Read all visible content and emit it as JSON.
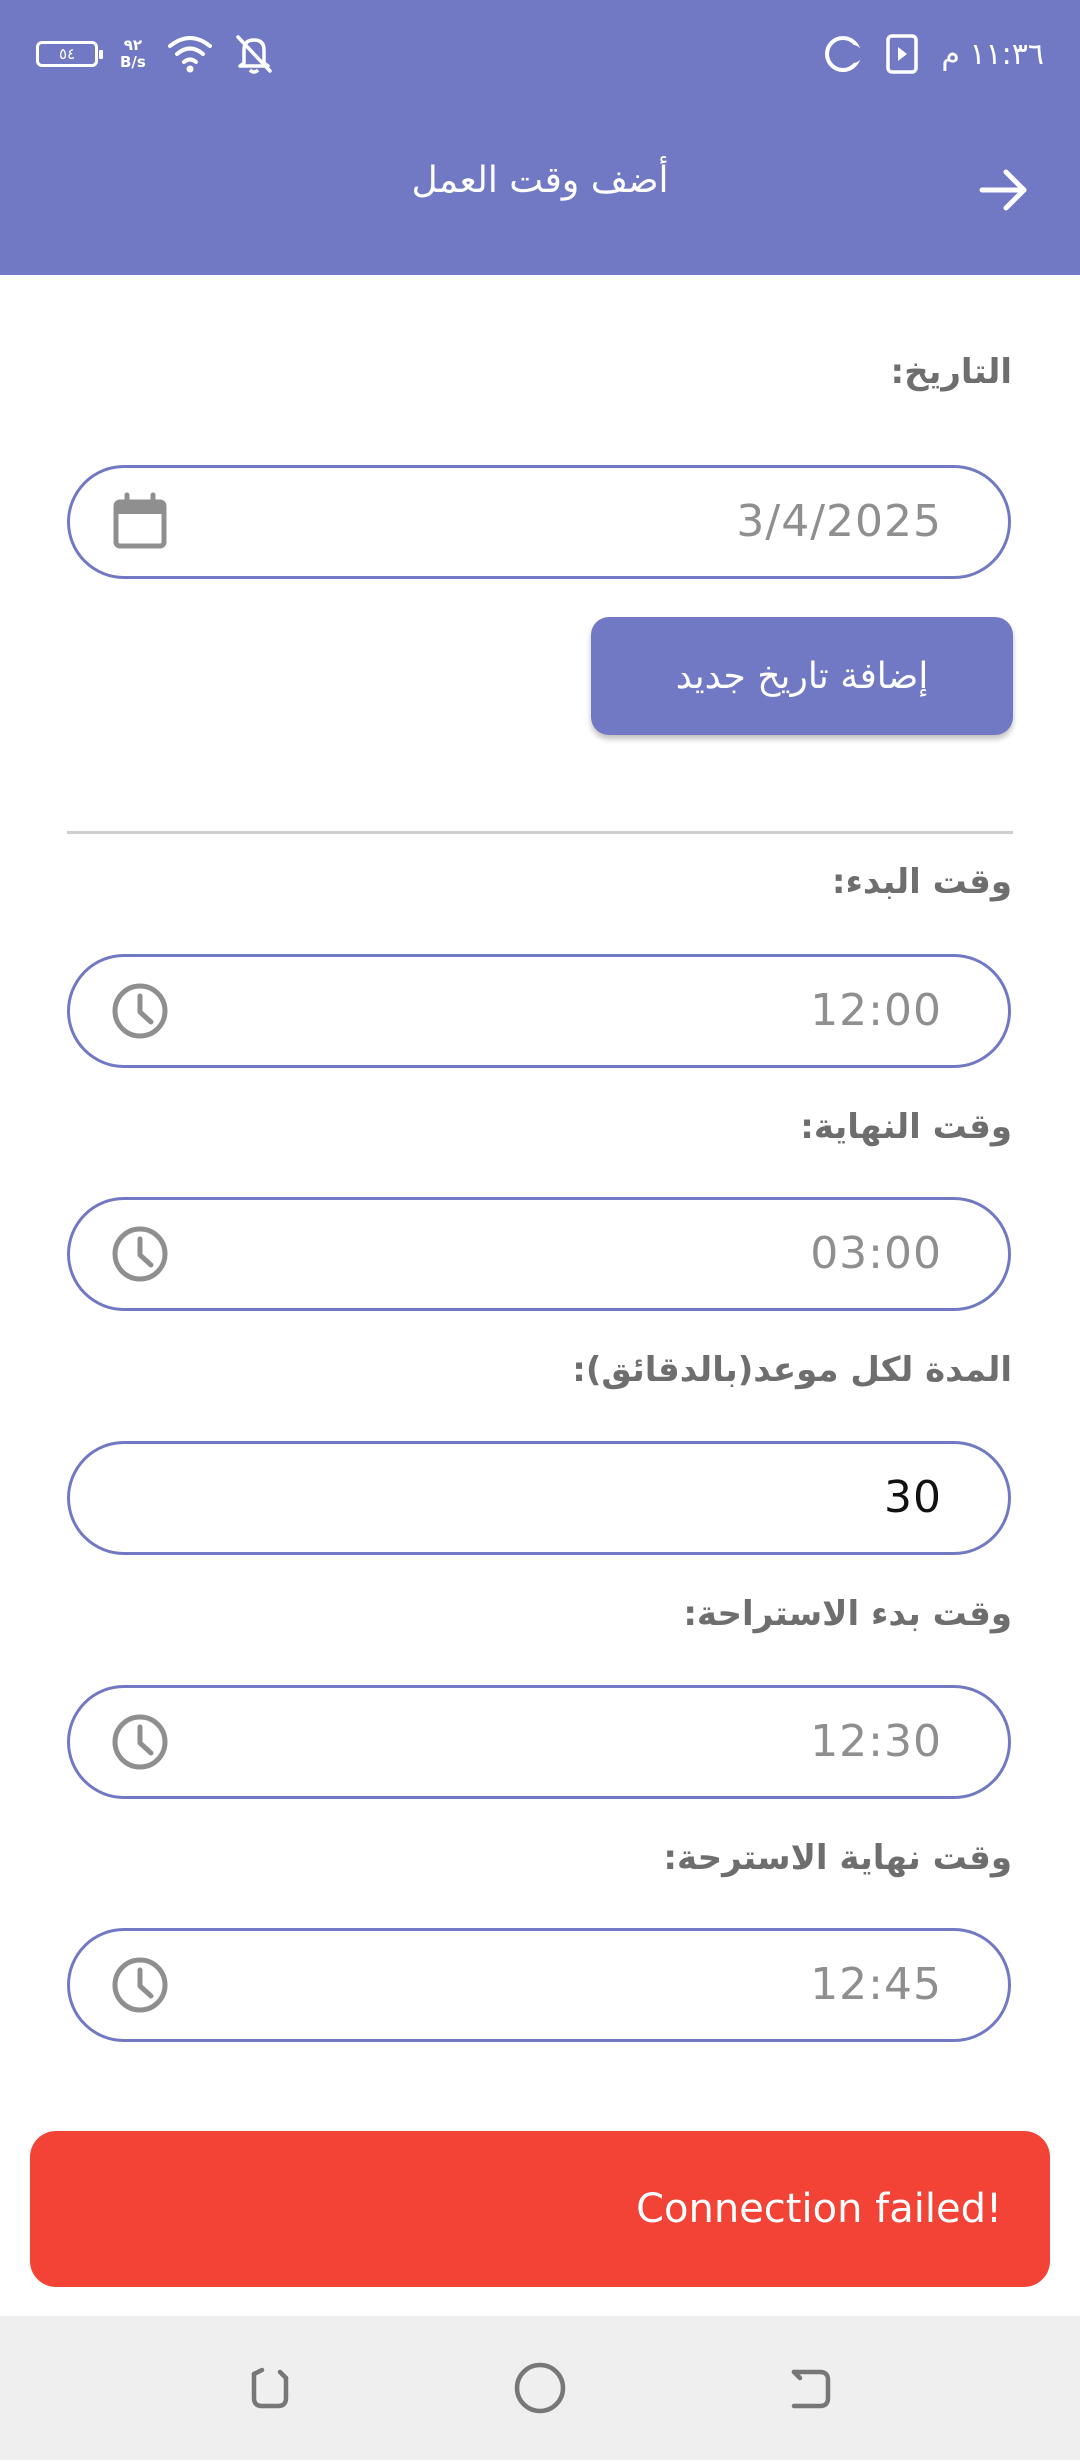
{
  "status_bar": {
    "battery": "٥٤",
    "net_speed_value": "٩٢",
    "net_speed_unit": "B/s",
    "time": "١١:٣٦ م"
  },
  "app_bar": {
    "title": "أضف وقت العمل"
  },
  "form": {
    "date": {
      "label": "التاريخ:",
      "value": "3/4/2025"
    },
    "add_date_button": "إضافة تاريخ جديد",
    "start_time": {
      "label": "وقت البدء:",
      "value": "12:00"
    },
    "end_time": {
      "label": "وقت النهاية:",
      "value": "03:00"
    },
    "duration": {
      "label": "المدة لكل موعد(بالدقائق):",
      "value": "30"
    },
    "break_start": {
      "label": "وقت بدء الاستراحة:",
      "value": "12:30"
    },
    "break_end": {
      "label": "وقت نهاية الاسترحة:",
      "value": "12:45"
    }
  },
  "snackbar": {
    "message": "Connection failed!"
  },
  "colors": {
    "primary": "#7279c4",
    "error": "#f34336",
    "navbar": "#efefef"
  },
  "icons": [
    "battery-icon",
    "wifi-icon",
    "bell-off-icon",
    "moon-icon",
    "media-icon",
    "arrow-right-icon",
    "calendar-icon",
    "clock-icon",
    "nav-recent-icon",
    "nav-home-icon",
    "nav-back-icon"
  ]
}
